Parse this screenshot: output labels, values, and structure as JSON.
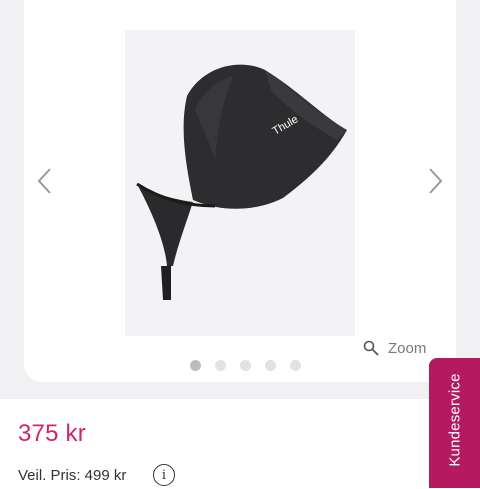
{
  "gallery": {
    "image_alt": "product-image",
    "brand_on_product": "Thule",
    "zoom_label": "Zoom",
    "dot_count": 5,
    "active_dot": 1
  },
  "product": {
    "price": "375 kr",
    "rrp": "Veil. Pris: 499 kr",
    "info_icon": "i"
  },
  "customer_service": {
    "label": "Kundeservice"
  },
  "colors": {
    "price": "#d1246e",
    "customer_service_bg": "#b5195f",
    "page_bg": "#f1f1f3"
  }
}
